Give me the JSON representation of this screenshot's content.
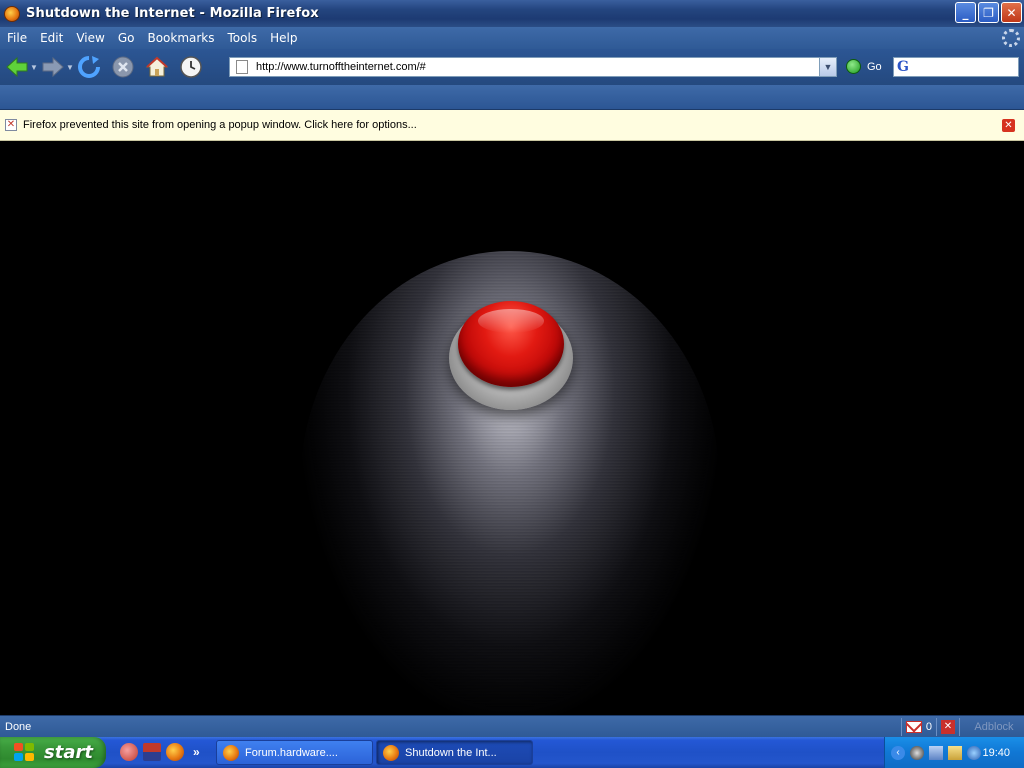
{
  "window": {
    "title": "Shutdown the Internet - Mozilla Firefox",
    "controls": {
      "minimize": "_",
      "restore": "❐",
      "close": "✕"
    }
  },
  "menubar": {
    "items": [
      "File",
      "Edit",
      "View",
      "Go",
      "Bookmarks",
      "Tools",
      "Help"
    ]
  },
  "navbar": {
    "url": "http://www.turnofftheinternet.com/#",
    "go_label": "Go",
    "search_value": "",
    "search_logo": "G"
  },
  "popup_notice": {
    "text": "Firefox prevented this site from opening a popup window. Click here for options...",
    "close": "✕"
  },
  "page": {
    "button_color": "#d61010"
  },
  "statusbar": {
    "status": "Done",
    "gmail_count": "0",
    "adblock_label": "Adblock"
  },
  "taskbar": {
    "start_label": "start",
    "quicklaunch_more": "»",
    "tasks": [
      {
        "label": "Forum.hardware...."
      },
      {
        "label": "Shutdown the Int..."
      }
    ],
    "clock": "19:40"
  }
}
